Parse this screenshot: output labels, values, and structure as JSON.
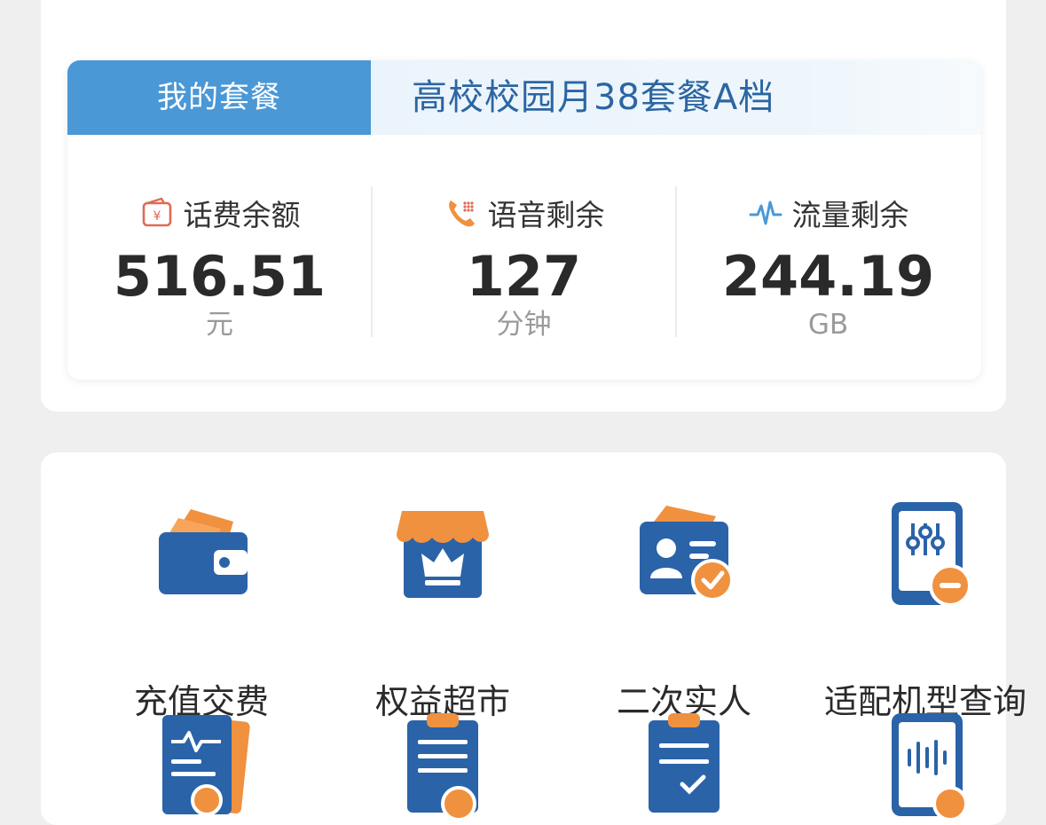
{
  "plan": {
    "tab_label": "我的套餐",
    "plan_name": "高校校园月38套餐A档"
  },
  "stats": [
    {
      "icon": "wallet-yuan-icon",
      "label": "话费余额",
      "value": "516.51",
      "unit": "元"
    },
    {
      "icon": "phone-call-icon",
      "label": "语音剩余",
      "value": "127",
      "unit": "分钟"
    },
    {
      "icon": "data-wave-icon",
      "label": "流量剩余",
      "value": "244.19",
      "unit": "GB"
    }
  ],
  "services": [
    {
      "icon": "wallet-icon",
      "label": "充值交费"
    },
    {
      "icon": "store-crown-icon",
      "label": "权益超市"
    },
    {
      "icon": "id-card-check-icon",
      "label": "二次实人"
    },
    {
      "icon": "phone-settings-icon",
      "label": "适配机型查询"
    },
    {
      "icon": "report-pulse-icon",
      "label": ""
    },
    {
      "icon": "clipboard-yuan-icon",
      "label": ""
    },
    {
      "icon": "clipboard-check-icon",
      "label": ""
    },
    {
      "icon": "phone-voice-icon",
      "label": ""
    }
  ],
  "colors": {
    "brand_blue": "#2a63a8",
    "tab_blue": "#4a98d6",
    "accent_orange": "#f0913f",
    "wallet_red": "#e06a55"
  }
}
